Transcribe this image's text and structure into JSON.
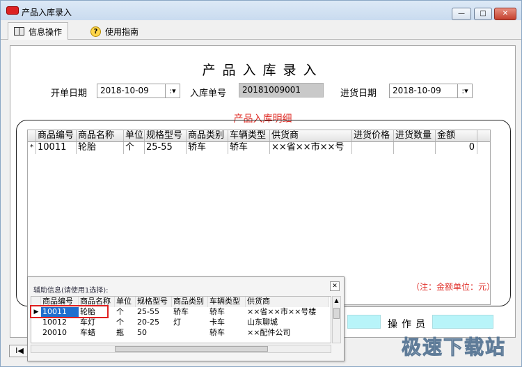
{
  "window": {
    "title": "产品入库录入",
    "controls": [
      "minimize",
      "maximize",
      "close"
    ]
  },
  "toolbar": {
    "tabs": [
      {
        "label": "信息操作",
        "icon": "book-icon"
      },
      {
        "label": "使用指南",
        "icon": "help-icon"
      }
    ]
  },
  "form": {
    "title": "产品入库录入",
    "order_date_label": "开单日期",
    "order_date_value": "2018-10-09",
    "stock_no_label": "入库单号",
    "stock_no_value": "20181009001",
    "purchase_date_label": "进货日期",
    "purchase_date_value": "2018-10-09",
    "detail_title": "产品入库明细"
  },
  "detail_grid": {
    "columns": [
      "商品编号",
      "商品名称",
      "单位",
      "规格型号",
      "商品类别",
      "车辆类型",
      "供货商",
      "进货价格",
      "进货数量",
      "金额"
    ],
    "rows": [
      [
        "10011",
        "轮胎",
        "个",
        "25-55",
        "轿车",
        "轿车",
        "××省××市××号",
        "",
        "",
        "0"
      ]
    ],
    "row_marker": "*"
  },
  "footer": {
    "unit_note": "（注：金额单位：元）",
    "operator_label": "操作员",
    "nav_first": "I◀"
  },
  "popup": {
    "title": "辅助信息(请使用1选择):",
    "columns": [
      "商品编号",
      "商品名称",
      "单位",
      "规格型号",
      "商品类别",
      "车辆类型",
      "供货商"
    ],
    "rows": [
      [
        "10011",
        "轮胎",
        "个",
        "25-55",
        "轿车",
        "轿车",
        "××省××市××号楼"
      ],
      [
        "10012",
        "车灯",
        "个",
        "20-25",
        "灯",
        "卡车",
        "山东聊城"
      ],
      [
        "20010",
        "车蜡",
        "瓶",
        "50",
        "",
        "轿车",
        "××配件公司"
      ]
    ],
    "selected_row": 0
  },
  "watermark": "极速下载站"
}
